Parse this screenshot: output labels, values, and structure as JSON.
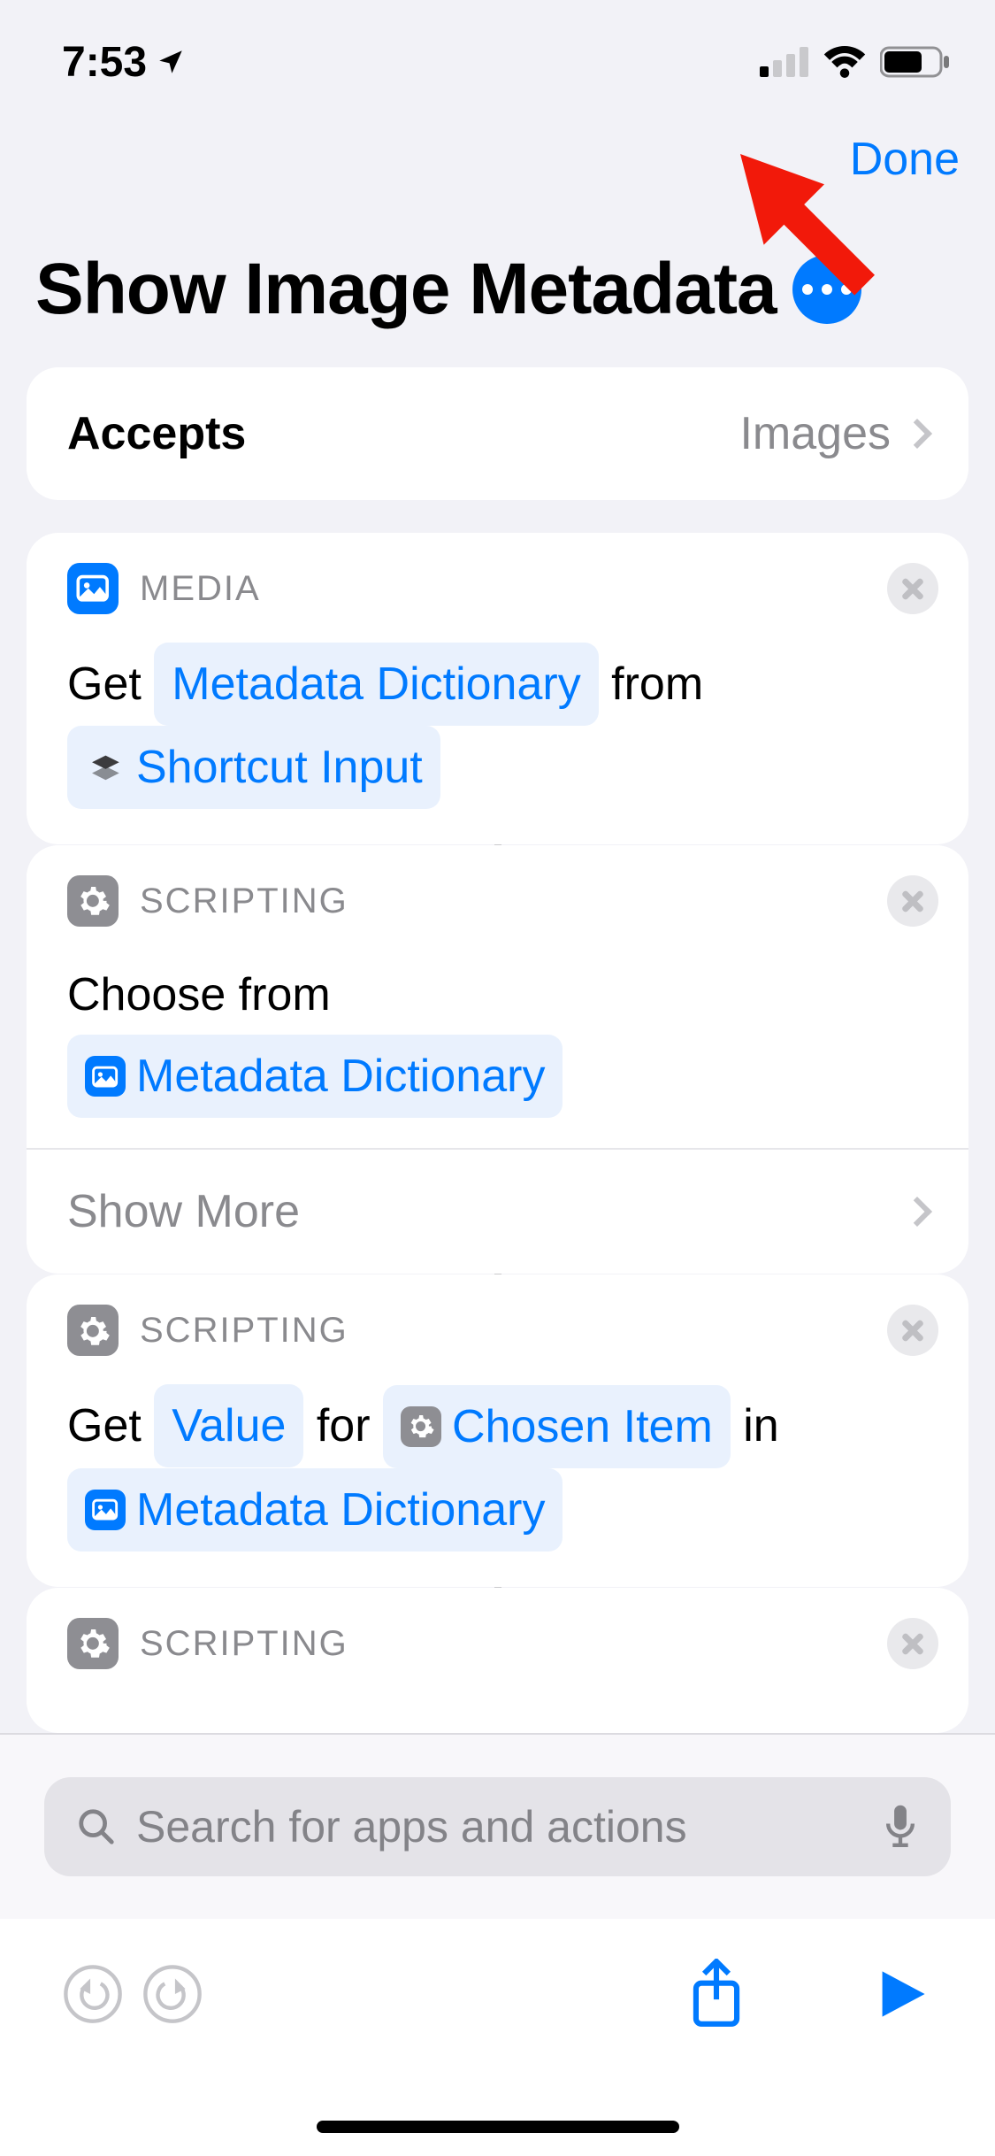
{
  "status": {
    "time": "7:53"
  },
  "nav": {
    "done": "Done"
  },
  "title": "Show Image Metadata",
  "accepts": {
    "label": "Accepts",
    "value": "Images"
  },
  "actions": [
    {
      "category": "MEDIA",
      "kind": "media",
      "lines": [
        [
          {
            "t": "text",
            "v": "Get "
          },
          {
            "t": "token",
            "v": "Metadata Dictionary"
          },
          {
            "t": "text",
            "v": " from"
          }
        ],
        [
          {
            "t": "token",
            "icon": "stack",
            "v": "Shortcut Input"
          }
        ]
      ]
    },
    {
      "category": "SCRIPTING",
      "kind": "scripting",
      "lines": [
        [
          {
            "t": "text",
            "v": "Choose from"
          }
        ],
        [
          {
            "t": "token",
            "icon": "media",
            "v": "Metadata Dictionary"
          }
        ]
      ],
      "showMore": "Show More"
    },
    {
      "category": "SCRIPTING",
      "kind": "scripting",
      "lines": [
        [
          {
            "t": "text",
            "v": "Get "
          },
          {
            "t": "token",
            "v": "Value"
          },
          {
            "t": "text",
            "v": " for "
          },
          {
            "t": "token",
            "icon": "scripting",
            "v": "Chosen Item"
          },
          {
            "t": "text",
            "v": " in"
          }
        ],
        [
          {
            "t": "token",
            "icon": "media",
            "v": "Metadata Dictionary"
          }
        ]
      ]
    },
    {
      "category": "SCRIPTING",
      "kind": "scripting",
      "lines": []
    }
  ],
  "search": {
    "placeholder": "Search for apps and actions"
  }
}
